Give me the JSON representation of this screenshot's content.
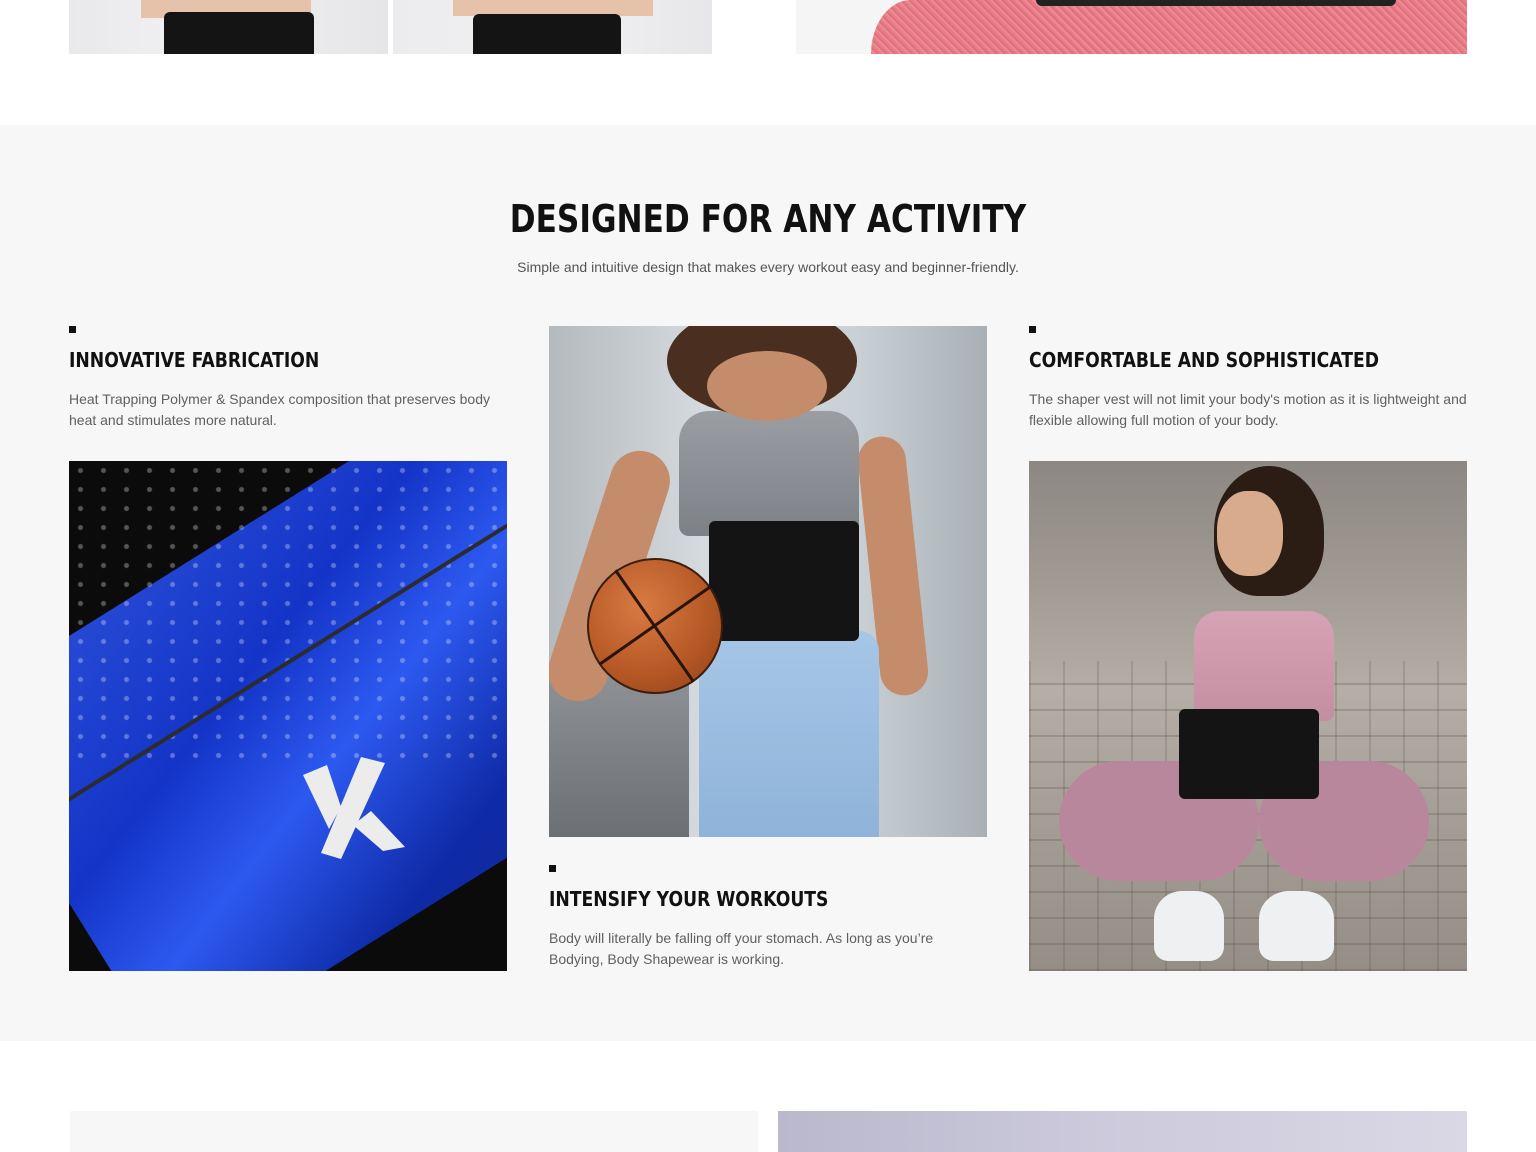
{
  "section": {
    "title": "DESIGNED FOR ANY ACTIVITY",
    "subtitle": "Simple and intuitive design that makes every workout easy and beginner-friendly."
  },
  "features": [
    {
      "title": "INNOVATIVE FABRICATION",
      "text": "Heat Trapping Polymer & Spandex composition that preserves body heat and stimulates more natural."
    },
    {
      "title": "INTENSIFY YOUR WORKOUTS",
      "text": "Body will literally be falling off your stomach. As long as you’re Bodying, Body Shapewear is working."
    },
    {
      "title": "COMFORTABLE AND SOPHISTICATED",
      "text": "The shaper vest will not limit your body's motion as it is lightweight and flexible allowing full motion of your body."
    }
  ],
  "photos": {
    "fabric": "fabric-closeup-photo",
    "basketball": "woman-with-basketball-photo",
    "crouching": "woman-crouching-photo"
  },
  "colors": {
    "section_bg": "#f7f7f7",
    "heading": "#111111",
    "body_text": "#606060"
  }
}
